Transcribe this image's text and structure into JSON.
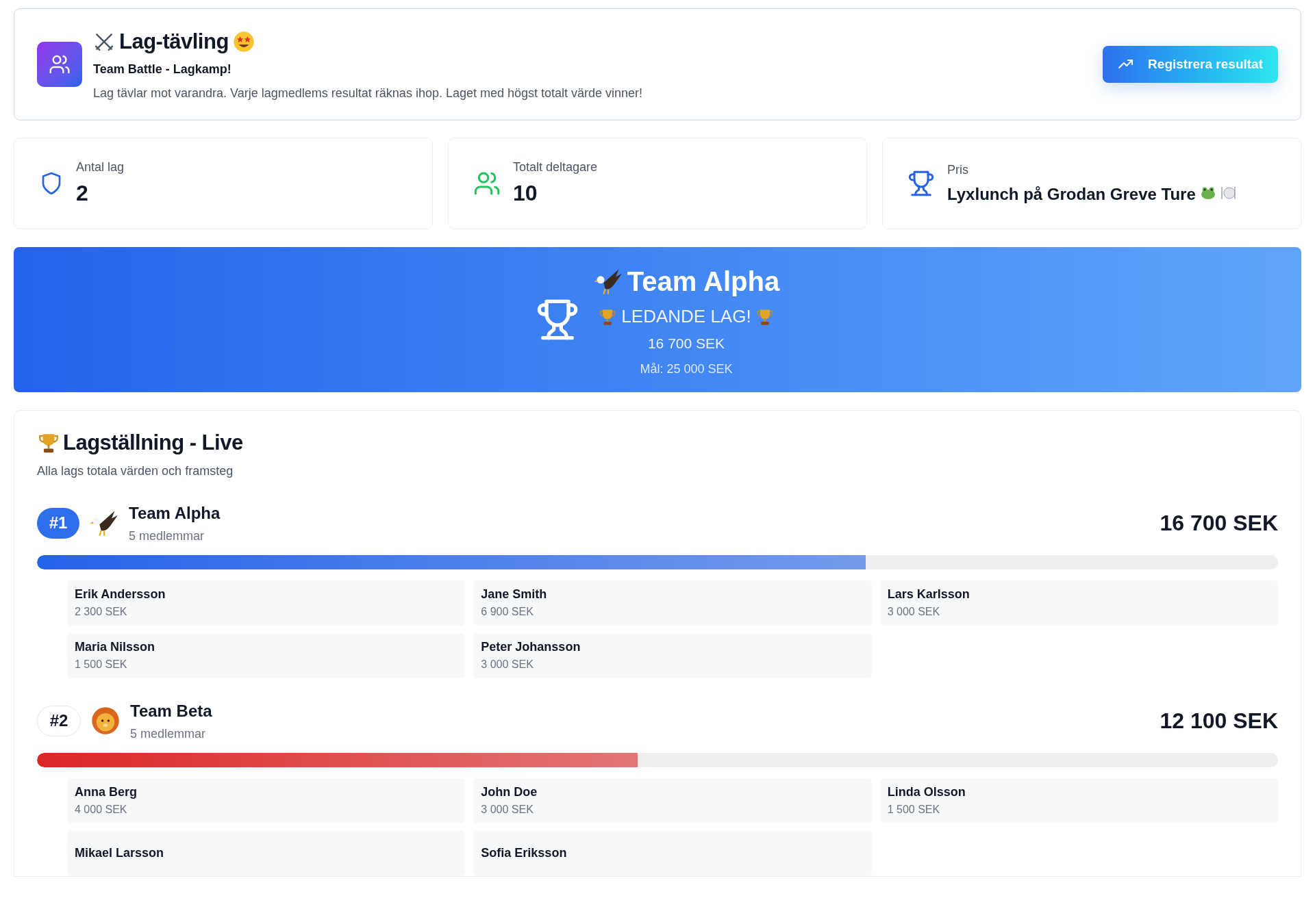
{
  "header": {
    "title": "Lag-tävling",
    "subtitle": "Team Battle - Lagkamp!",
    "description": "Lag tävlar mot varandra. Varje lagmedlems resultat räknas ihop. Laget med högst totalt värde vinner!",
    "button": "Registrera resultat"
  },
  "stats": [
    {
      "kind": "teams",
      "label": "Antal lag",
      "value": "2"
    },
    {
      "kind": "participants",
      "label": "Totalt deltagare",
      "value": "10"
    },
    {
      "kind": "prize",
      "label": "Pris",
      "value": "Lyxlunch på Grodan Greve Ture"
    }
  ],
  "leader": {
    "emblem": {
      "kind": "eagle"
    },
    "name": "Team Alpha",
    "tagline": "LEDANDE LAG!",
    "total": "16 700 SEK",
    "goal": "Mål: 25 000 SEK"
  },
  "standings": {
    "title": "Lagställning - Live",
    "subtitle": "Alla lags totala värden och framsteg",
    "teams": [
      {
        "rank": "#1",
        "leading": true,
        "emblem": {
          "kind": "eagle"
        },
        "name": "Team Alpha",
        "members_count": "5 medlemmar",
        "total": "16 700 SEK",
        "level": 0.668,
        "color": "#2563eb",
        "members": [
          {
            "name": "Erik Andersson",
            "amount": "2 300 SEK"
          },
          {
            "name": "Jane Smith",
            "amount": "6 900 SEK"
          },
          {
            "name": "Lars Karlsson",
            "amount": "3 000 SEK"
          },
          {
            "name": "Maria Nilsson",
            "amount": "1 500 SEK"
          },
          {
            "name": "Peter Johansson",
            "amount": "3 000 SEK"
          }
        ]
      },
      {
        "rank": "#2",
        "leading": false,
        "emblem": {
          "kind": "lion"
        },
        "name": "Team Beta",
        "members_count": "5 medlemmar",
        "total": "12 100 SEK",
        "level": 0.484,
        "color": "#dc2626",
        "members": [
          {
            "name": "Anna Berg",
            "amount": "4 000 SEK"
          },
          {
            "name": "John Doe",
            "amount": "3 000 SEK"
          },
          {
            "name": "Linda Olsson",
            "amount": "1 500 SEK"
          },
          {
            "name": "Mikael Larsson"
          },
          {
            "name": "Sofia Eriksson"
          }
        ]
      }
    ]
  }
}
